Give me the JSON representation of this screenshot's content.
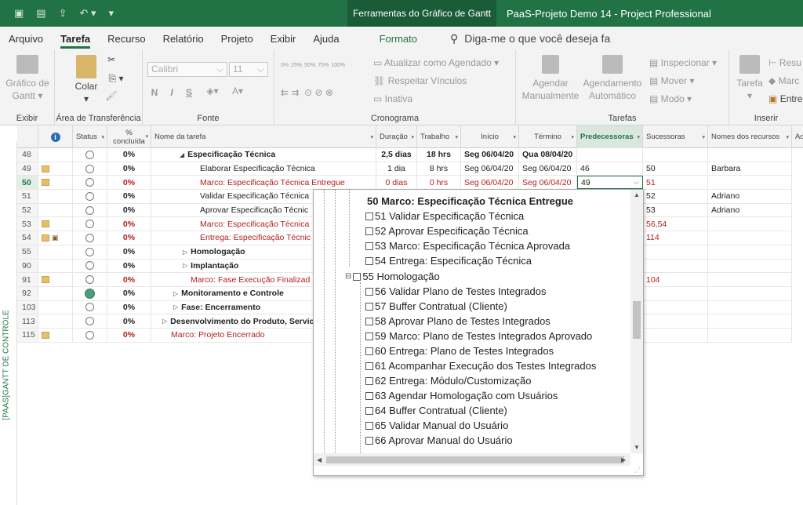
{
  "title_bar": {
    "context_tab": "Ferramentas do Gráfico de Gantt",
    "window_title": "PaaS-Projeto Demo 14  -  Project Professional"
  },
  "tabs": [
    {
      "label": "Arquivo"
    },
    {
      "label": "Tarefa"
    },
    {
      "label": "Recurso"
    },
    {
      "label": "Relatório"
    },
    {
      "label": "Projeto"
    },
    {
      "label": "Exibir"
    },
    {
      "label": "Ajuda"
    }
  ],
  "format_tab": "Formato",
  "tell_me": "Diga-me o que você deseja fa",
  "ribbon": {
    "gantt_button": "Gráfico de Gantt",
    "paste": "Colar",
    "font_name": "Calibri",
    "font_size": "11",
    "bold": "N",
    "italic": "I",
    "underline": "S",
    "update_schedule": "Atualizar como Agendado",
    "respect_links": "Respeitar Vínculos",
    "inactive": "Inativa",
    "manual": "Agendar Manualmente",
    "auto": "Agendamento Automático",
    "inspect": "Inspecionar",
    "move": "Mover",
    "mode": "Modo",
    "task": "Tarefa",
    "summary": "Resu",
    "milestone": "Marc",
    "deliverable": "Entre",
    "pct_labels": [
      "0%",
      "25%",
      "50%",
      "75%",
      "100%"
    ],
    "groups": {
      "exibir": "Exibir",
      "clipboard": "Área de Transferência",
      "font": "Fonte",
      "schedule": "Cronograma",
      "tasks": "Tarefas",
      "insert": "Inserir"
    }
  },
  "sidebar_label": "[PAAS]GANTT DE CONTROLE",
  "columns": {
    "status": "Status",
    "pct": "% concluída",
    "name": "Nome da tarefa",
    "duration": "Duração",
    "work": "Trabalho",
    "start": "Início",
    "finish": "Término",
    "predecessors": "Predecessoras",
    "successors": "Sucessoras",
    "resources": "Nomes dos recursos",
    "more": "Adi"
  },
  "rows": [
    {
      "id": "48",
      "pct": "0%",
      "name": "Especificação Técnica",
      "dur": "2,5 dias",
      "work": "18 hrs",
      "start": "Seg 06/04/20",
      "finish": "Qua 08/04/20",
      "pred": "",
      "succ": "",
      "res": ""
    },
    {
      "id": "49",
      "pct": "0%",
      "name": "Elaborar Especificação Técnica",
      "dur": "1 dia",
      "work": "8 hrs",
      "start": "Seg 06/04/20",
      "finish": "Seg 06/04/20",
      "pred": "46",
      "succ": "50",
      "res": "Barbara"
    },
    {
      "id": "50",
      "pct": "0%",
      "name": "Marco: Especificação Técnica Entregue",
      "dur": "0 dias",
      "work": "0 hrs",
      "start": "Seg 06/04/20",
      "finish": "Seg 06/04/20",
      "pred": "49",
      "succ": "51",
      "res": ""
    },
    {
      "id": "51",
      "pct": "0%",
      "name": "Validar Especificação Técnica",
      "dur": "",
      "work": "",
      "start": "",
      "finish": "",
      "pred": "",
      "succ": "52",
      "res": "Adriano"
    },
    {
      "id": "52",
      "pct": "0%",
      "name": "Aprovar Especificação Técnic",
      "dur": "",
      "work": "",
      "start": "",
      "finish": "",
      "pred": "",
      "succ": "53",
      "res": "Adriano"
    },
    {
      "id": "53",
      "pct": "0%",
      "name": "Marco: Especificação Técnica",
      "dur": "",
      "work": "",
      "start": "",
      "finish": "",
      "pred": "",
      "succ": "56,54",
      "res": ""
    },
    {
      "id": "54",
      "pct": "0%",
      "name": "Entrega: Especificação Técnic",
      "dur": "",
      "work": "",
      "start": "",
      "finish": "",
      "pred": "",
      "succ": "114",
      "res": ""
    },
    {
      "id": "55",
      "pct": "0%",
      "name": "Homologação",
      "dur": "",
      "work": "",
      "start": "",
      "finish": "",
      "pred": "",
      "succ": "",
      "res": ""
    },
    {
      "id": "90",
      "pct": "0%",
      "name": "Implantação",
      "dur": "",
      "work": "",
      "start": "",
      "finish": "",
      "pred": "",
      "succ": "",
      "res": ""
    },
    {
      "id": "91",
      "pct": "0%",
      "name": "Marco: Fase Execução Finalizad",
      "dur": "",
      "work": "",
      "start": "",
      "finish": "",
      "pred": "",
      "succ": "104",
      "res": ""
    },
    {
      "id": "92",
      "pct": "0%",
      "name": "Monitoramento e Controle",
      "dur": "",
      "work": "",
      "start": "",
      "finish": "",
      "pred": "",
      "succ": "",
      "res": ""
    },
    {
      "id": "103",
      "pct": "0%",
      "name": "Fase: Encerramento",
      "dur": "",
      "work": "",
      "start": "",
      "finish": "",
      "pred": "",
      "succ": "",
      "res": ""
    },
    {
      "id": "113",
      "pct": "0%",
      "name": "Desenvolvimento do Produto, Servic",
      "dur": "",
      "work": "",
      "start": "",
      "finish": "",
      "pred": "",
      "succ": "",
      "res": ""
    },
    {
      "id": "115",
      "pct": "0%",
      "name": "Marco: Projeto Encerrado",
      "dur": "",
      "work": "",
      "start": "",
      "finish": "",
      "pred": "",
      "succ": "",
      "res": ""
    }
  ],
  "dropdown": {
    "items": [
      {
        "label": "50  Marco: Especificação Técnica Entregue"
      },
      {
        "label": "51  Validar Especificação Técnica"
      },
      {
        "label": "52  Aprovar Especificação Técnica"
      },
      {
        "label": "53  Marco: Especificação Técnica Aprovada"
      },
      {
        "label": "54  Entrega: Especificação Técnica"
      },
      {
        "label": "55  Homologação"
      },
      {
        "label": "56  Validar Plano de Testes Integrados"
      },
      {
        "label": "57  Buffer Contratual (Cliente)"
      },
      {
        "label": "58  Aprovar Plano de Testes Integrados"
      },
      {
        "label": "59  Marco: Plano de Testes Integrados Aprovado"
      },
      {
        "label": "60  Entrega: Plano de Testes Integrados"
      },
      {
        "label": "61  Acompanhar Execução dos Testes Integrados"
      },
      {
        "label": "62  Entrega: Módulo/Customização"
      },
      {
        "label": "63  Agendar Homologação com Usuários"
      },
      {
        "label": "64  Buffer Contratual (Cliente)"
      },
      {
        "label": "65  Validar Manual do Usuário"
      },
      {
        "label": "66  Aprovar Manual do Usuário"
      }
    ]
  }
}
